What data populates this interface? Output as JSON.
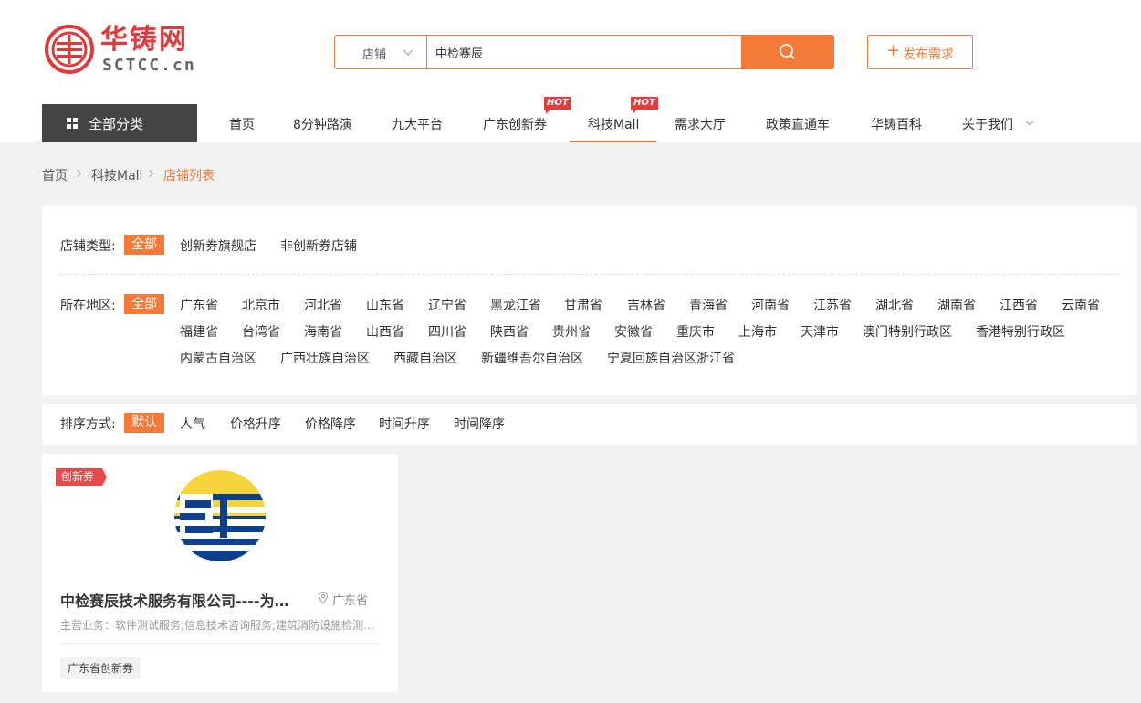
{
  "brand": {
    "name_cn": "华铸网",
    "name_en": "SCTCC.cn",
    "color": "#e23a3a"
  },
  "accent": "#f47a3a",
  "search": {
    "type_label": "店铺",
    "value": "中检赛辰",
    "button_icon": "search-icon"
  },
  "publish": {
    "label": "发布需求",
    "icon": "plus-icon"
  },
  "nav": {
    "all_categories": "全部分类",
    "items": [
      {
        "label": "首页"
      },
      {
        "label": "8分钟路演"
      },
      {
        "label": "九大平台"
      },
      {
        "label": "广东创新券",
        "badge": "HOT"
      },
      {
        "label": "科技Mall",
        "badge": "HOT",
        "active": true
      },
      {
        "label": "需求大厅"
      },
      {
        "label": "政策直通车"
      },
      {
        "label": "华铸百科"
      },
      {
        "label": "关于我们"
      }
    ]
  },
  "breadcrumb": [
    "首页",
    "科技Mall",
    "店铺列表"
  ],
  "filters": {
    "shop_type": {
      "label": "店铺类型:",
      "options": [
        "全部",
        "创新券旗舰店",
        "非创新券店铺"
      ],
      "selected": "全部"
    },
    "region": {
      "label": "所在地区:",
      "selected": "全部",
      "options": [
        "广东省",
        "北京市",
        "河北省",
        "山东省",
        "辽宁省",
        "黑龙江省",
        "甘肃省",
        "吉林省",
        "青海省",
        "河南省",
        "江苏省",
        "湖北省",
        "湖南省",
        "江西省",
        "云南省",
        "福建省",
        "台湾省",
        "海南省",
        "山西省",
        "四川省",
        "陕西省",
        "贵州省",
        "安徽省",
        "重庆市",
        "上海市",
        "天津市",
        "澳门特别行政区",
        "香港特别行政区",
        "内蒙古自治区",
        "广西壮族自治区",
        "西藏自治区",
        "新疆维吾尔自治区",
        "宁夏回族自治区",
        "浙江省"
      ]
    }
  },
  "sort": {
    "label": "排序方式:",
    "options": [
      "默认",
      "人气",
      "价格升序",
      "价格降序",
      "时间升序",
      "时间降序"
    ],
    "selected": "默认"
  },
  "shops": [
    {
      "tag": "创新券",
      "name": "中检赛辰技术服务有限公司----为国家级质检中心提供技术服务",
      "location": "广东省",
      "business": "主营业务：软件测试服务;信息技术咨询服务;建筑消防设施检测服务",
      "badge": "广东省创新券",
      "logo_colors": {
        "sun": "#f5d33a",
        "sea": "#0e3f8c"
      }
    }
  ]
}
